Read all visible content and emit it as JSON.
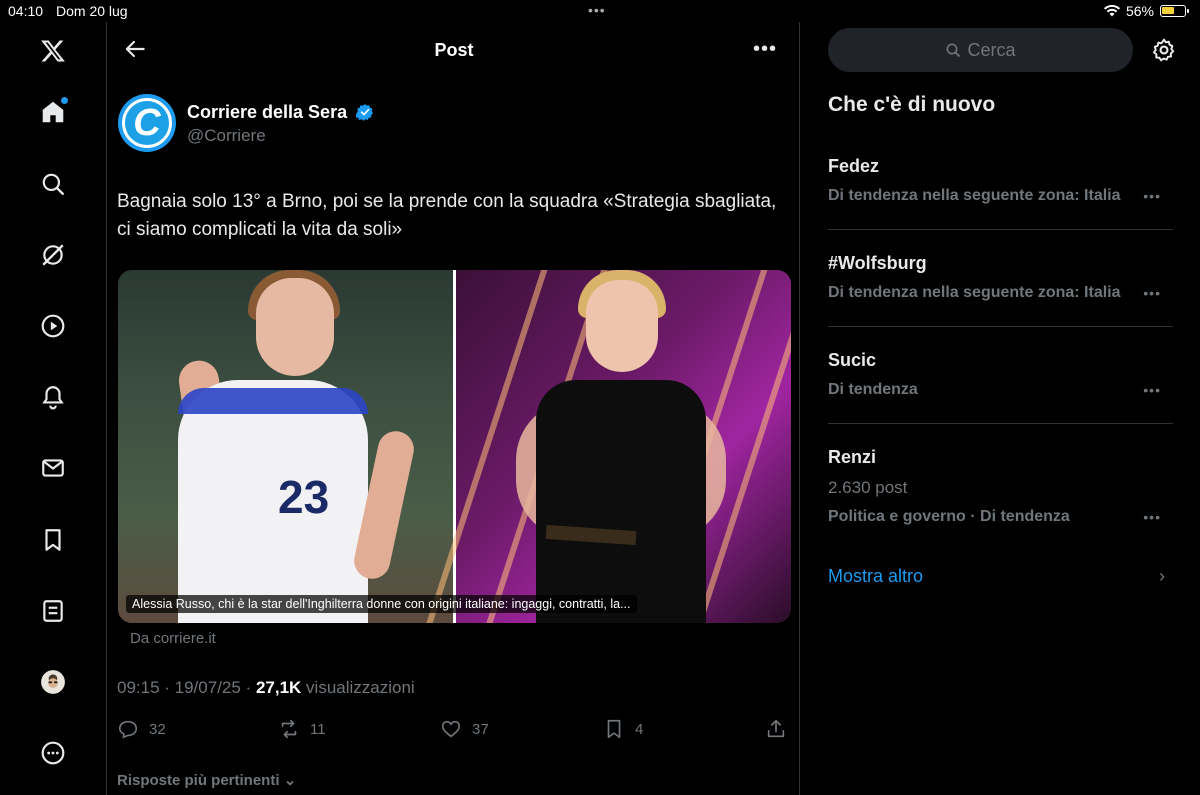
{
  "status_bar": {
    "time": "04:10",
    "date": "Dom 20 lug",
    "battery": "56%"
  },
  "sidebar": {
    "items": [
      "X logo",
      "Home",
      "Explore",
      "Grok",
      "Video",
      "Notifications",
      "Messages",
      "Bookmarks",
      "Lists",
      "Profile",
      "More"
    ]
  },
  "header": {
    "title": "Post"
  },
  "post": {
    "author_name": "Corriere della Sera",
    "author_handle": "@Corriere",
    "avatar_letter": "C",
    "text": "Bagnaia solo 13° a Brno, poi se la prende con la squadra «Strategia sbagliata, ci siamo complicati la vita da soli»",
    "media_caption": "Alessia Russo, chi è la star dell'Inghilterra donne con origini italiane: ingaggi, contratti, la...",
    "jersey_number": "23",
    "source": "Da corriere.it",
    "time_date": "09:15 · 19/07/25 · ",
    "views_count": "27,1K",
    "views_label": " visualizzazioni",
    "replies": "32",
    "reposts": "11",
    "likes": "37",
    "bookmarks": "4",
    "sort_label": "Risposte più pertinenti"
  },
  "right_panel": {
    "search_placeholder": "Cerca",
    "trends_title": "Che c'è di nuovo",
    "trends": [
      {
        "name": "Fedez",
        "count": "",
        "context": "Di tendenza nella seguente zona: Italia"
      },
      {
        "name": "#Wolfsburg",
        "count": "",
        "context": "Di tendenza nella seguente zona: Italia"
      },
      {
        "name": "Sucic",
        "count": "",
        "context": "Di tendenza"
      },
      {
        "name": "Renzi",
        "count": "2.630 post",
        "context": "Politica e governo · Di tendenza"
      }
    ],
    "show_more": "Mostra altro"
  },
  "colors": {
    "accent": "#1d9bf0",
    "background": "#000000",
    "muted_text": "#71767b",
    "divider": "#2f3336"
  }
}
